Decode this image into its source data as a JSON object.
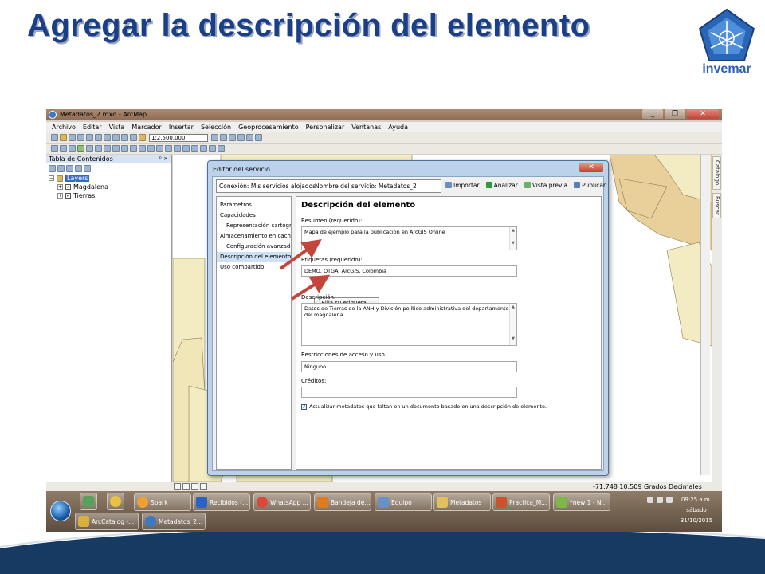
{
  "slide": {
    "title": "Agregar la descripción del elemento",
    "logo_text": "invemar"
  },
  "window": {
    "title": "Metadatos_2.mxd - ArcMap",
    "buttons": [
      "_",
      "❐",
      "✕"
    ]
  },
  "menu": [
    "Archivo",
    "Editar",
    "Vista",
    "Marcador",
    "Insertar",
    "Selección",
    "Geoprocesamiento",
    "Personalizar",
    "Ventanas",
    "Ayuda"
  ],
  "toolbar": {
    "scale": "1:2.500.000"
  },
  "toc": {
    "title": "Tabla de Contenidos",
    "pin": "ᵖ ×",
    "root": "Layers",
    "layers": [
      "Magdalena",
      "Tierras"
    ]
  },
  "side_tabs": [
    "Catálogo",
    "Buscar"
  ],
  "status": {
    "coords": "-71.748  10.509 Grados Decimales"
  },
  "dialog": {
    "title": "Editor del servicio",
    "connection": "Conexión: Mis servicios alojados",
    "service_name": "Nombre del servicio: Metadatos_2",
    "actions": [
      "Importar",
      "Analizar",
      "Vista previa",
      "Publicar"
    ],
    "nav": [
      {
        "label": "Parámetros",
        "sub": false
      },
      {
        "label": "Capacidades",
        "sub": false
      },
      {
        "label": "Representación cartográfi",
        "sub": true
      },
      {
        "label": "Almacenamiento en caché",
        "sub": false
      },
      {
        "label": "Configuración avanzada",
        "sub": true
      },
      {
        "label": "Descripción del elemento",
        "sub": false
      },
      {
        "label": "Uso compartido",
        "sub": false
      }
    ],
    "content": {
      "heading": "Descripción del elemento",
      "summary_label": "Resumen (requerido):",
      "summary_value": "Mapa de ejemplo para la publicación en ArcGIS Online",
      "tags_label": "Etiquetas (requerido):",
      "tags_value": "DEMO, OTGA, ArcGIS, Colombia",
      "choose_tags_button": "Elija su etiqueta...",
      "description_label": "Descripción:",
      "description_value": "Datos de Tierras de la ANH y División político administrativa del departamento del magdalena",
      "access_label": "Restricciones de acceso y uso",
      "access_value": "Ninguno",
      "credits_label": "Créditos:",
      "credits_value": "",
      "update_metadata_label": "Actualizar metadatos que faltan en un documento basado en una descripción de elemento.",
      "update_metadata_checked": true
    }
  },
  "taskbar": {
    "top_row": [
      "Spark",
      "Recibidos (...",
      "WhatsApp ...",
      "Bandeja de...",
      "Equipo",
      "Metadatos",
      "Practica_M...",
      "*new 1 - N..."
    ],
    "bottom_row": [
      "ArcCatalog -...",
      "Metadatos_2..."
    ],
    "clock_time": "09:25 a.m.",
    "clock_day": "sábado",
    "clock_date": "31/10/2015"
  },
  "colors": {
    "title_blue": "#1b3f86",
    "map_yellow": "#f3ecc3",
    "map_tan": "#e9cf9a",
    "arrow_red": "#c4453b",
    "wave_navy": "#163a62"
  }
}
